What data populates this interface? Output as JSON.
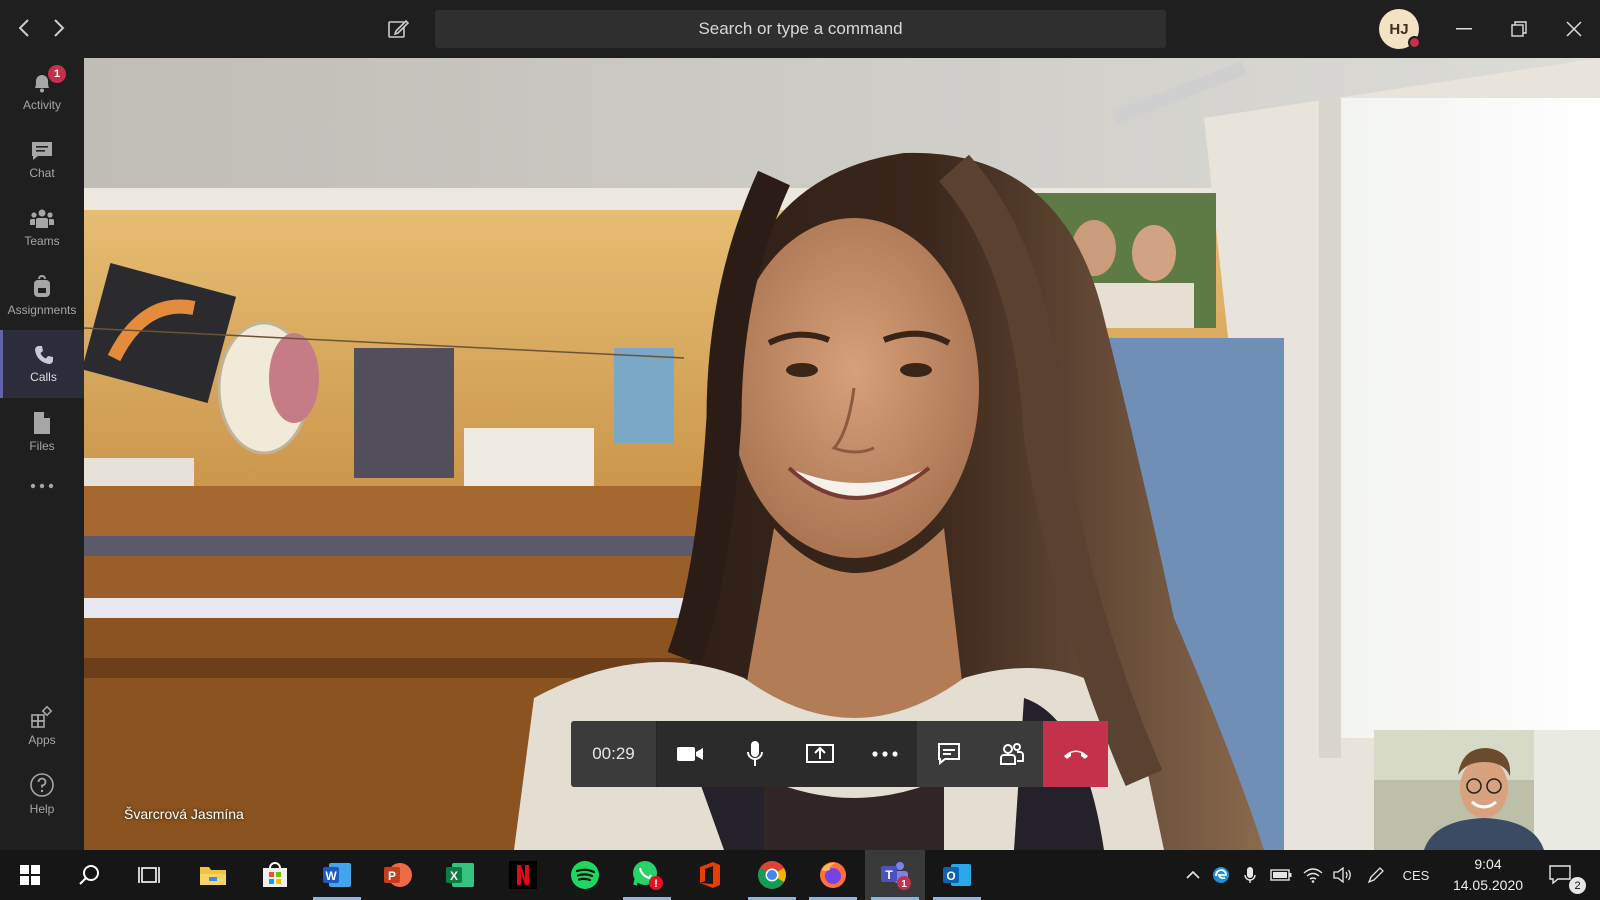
{
  "topbar": {
    "search_placeholder": "Search or type a command",
    "user_initials": "HJ",
    "presence_color": "#c4314b"
  },
  "rail": {
    "items": [
      {
        "label": "Activity",
        "icon": "bell-icon",
        "badge": "1"
      },
      {
        "label": "Chat",
        "icon": "chat-icon"
      },
      {
        "label": "Teams",
        "icon": "teams-icon"
      },
      {
        "label": "Assignments",
        "icon": "backpack-icon"
      },
      {
        "label": "Calls",
        "icon": "phone-icon",
        "active": true
      },
      {
        "label": "Files",
        "icon": "file-icon"
      },
      {
        "label": "Apps",
        "icon": "apps-icon"
      },
      {
        "label": "Help",
        "icon": "help-icon"
      }
    ],
    "accent": "#6264a7"
  },
  "call": {
    "participant_name": "Švarcrová Jasmína",
    "timer": "00:29",
    "controls": [
      "camera-icon",
      "microphone-icon",
      "share-screen-icon",
      "more-options-icon",
      "chat-icon",
      "participants-icon",
      "hang-up-icon"
    ],
    "hangup_color": "#c4314b"
  },
  "taskbar": {
    "apps": [
      "Start",
      "Search",
      "Task View",
      "File Explorer",
      "Microsoft Store",
      "Word",
      "PowerPoint",
      "Excel",
      "Netflix",
      "Spotify",
      "WhatsApp",
      "Office",
      "Chrome",
      "Firefox",
      "Microsoft Teams",
      "Outlook"
    ],
    "teams_badge": "1",
    "language": "CES",
    "time": "9:04",
    "date": "14.05.2020",
    "notification_count": "2"
  }
}
